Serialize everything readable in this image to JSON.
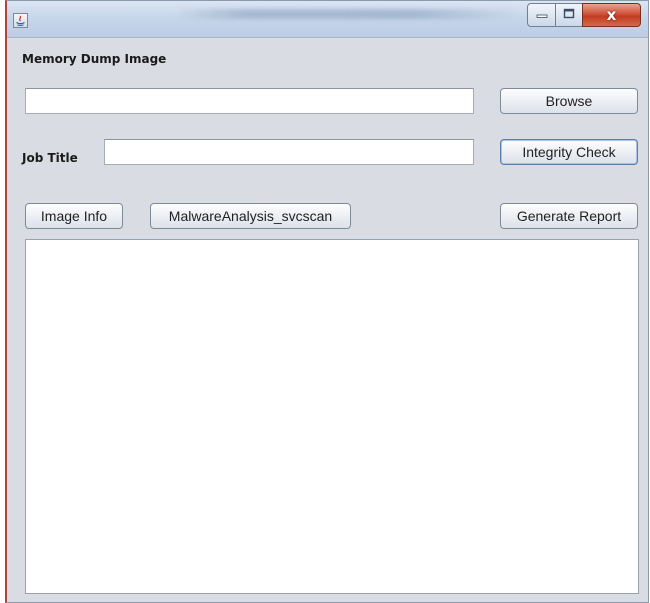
{
  "window": {
    "close_glyph": "x"
  },
  "labels": {
    "memory_dump_image": "Memory Dump Image",
    "job_title": "Job Title"
  },
  "inputs": {
    "image_path": {
      "value": "",
      "placeholder": ""
    },
    "job_title": {
      "value": "",
      "placeholder": ""
    }
  },
  "buttons": {
    "browse": "Browse",
    "integrity_check": "Integrity Check",
    "image_info": "Image Info",
    "malware_analysis": "MalwareAnalysis_svcscan",
    "generate_report": "Generate Report"
  },
  "output": {
    "text": ""
  },
  "icons": {
    "app": "java-icon",
    "minimize": "minimize-icon",
    "maximize": "maximize-icon",
    "close": "close-icon"
  },
  "colors": {
    "window_bg": "#d9dde3",
    "close_red": "#c23b22",
    "titlebar": "#c7d6ea"
  }
}
